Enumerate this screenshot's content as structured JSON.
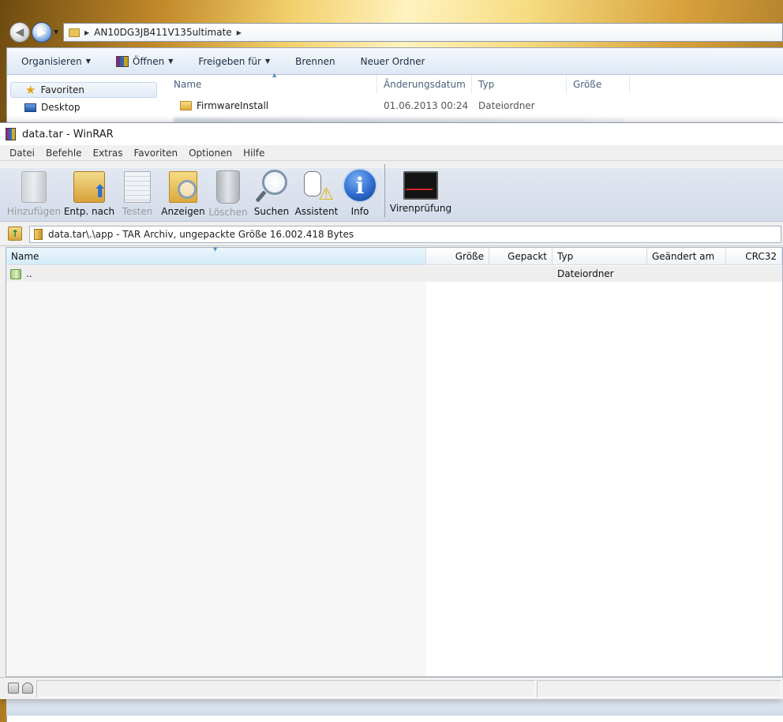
{
  "explorer": {
    "address_path": "AN10DG3JB411V135ultimate",
    "toolbar": {
      "organize": "Organisieren",
      "open": "Öffnen",
      "share": "Freigeben für",
      "burn": "Brennen",
      "new_folder": "Neuer Ordner"
    },
    "sidebar": {
      "favorites": "Favoriten",
      "desktop": "Desktop"
    },
    "columns": {
      "name": "Name",
      "modified": "Änderungsdatum",
      "type": "Typ",
      "size": "Größe"
    },
    "rows": [
      {
        "name": "FirmwareInstall",
        "modified": "01.06.2013 00:24",
        "type": "Dateiordner"
      }
    ]
  },
  "winrar": {
    "title": "data.tar - WinRAR",
    "menu": [
      "Datei",
      "Befehle",
      "Extras",
      "Favoriten",
      "Optionen",
      "Hilfe"
    ],
    "toolbar": {
      "add": "Hinzufügen",
      "extract": "Entp. nach",
      "test": "Testen",
      "view": "Anzeigen",
      "delete": "Löschen",
      "find": "Suchen",
      "wizard": "Assistent",
      "info": "Info",
      "virus_scan": "Virenprüfung"
    },
    "path": "data.tar\\.\\app - TAR Archiv, ungepackte Größe 16.002.418 Bytes",
    "columns": {
      "name": "Name",
      "size": "Größe",
      "packed": "Gepackt",
      "type": "Typ",
      "modified": "Geändert am",
      "crc": "CRC32"
    },
    "rows": [
      {
        "name": "..",
        "type": "Dateiordner"
      }
    ]
  },
  "icons": {
    "back": "back-arrow-icon",
    "forward": "forward-arrow-icon",
    "favorites": "star-icon",
    "folder": "folder-icon",
    "info": "info-icon"
  }
}
